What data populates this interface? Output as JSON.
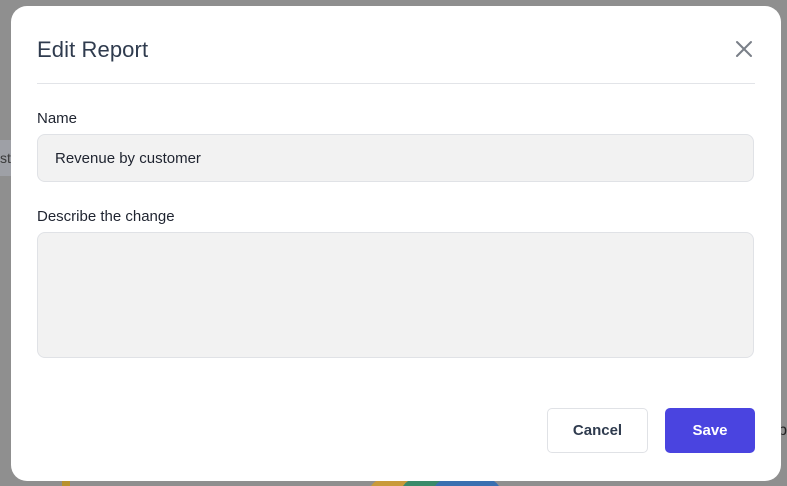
{
  "background": {
    "left_fragment": "sto",
    "right_fragment": "p"
  },
  "modal": {
    "title": "Edit Report",
    "close_icon": "close-icon",
    "name_field": {
      "label": "Name",
      "value": "Revenue by customer",
      "placeholder": ""
    },
    "description_field": {
      "label": "Describe the change",
      "value": "",
      "placeholder": ""
    },
    "buttons": {
      "cancel_label": "Cancel",
      "save_label": "Save"
    }
  },
  "colors": {
    "primary": "#4a44e0",
    "title_text": "#2f3b4e",
    "input_bg": "#f2f2f2",
    "overlay": "#8f8f8f"
  }
}
